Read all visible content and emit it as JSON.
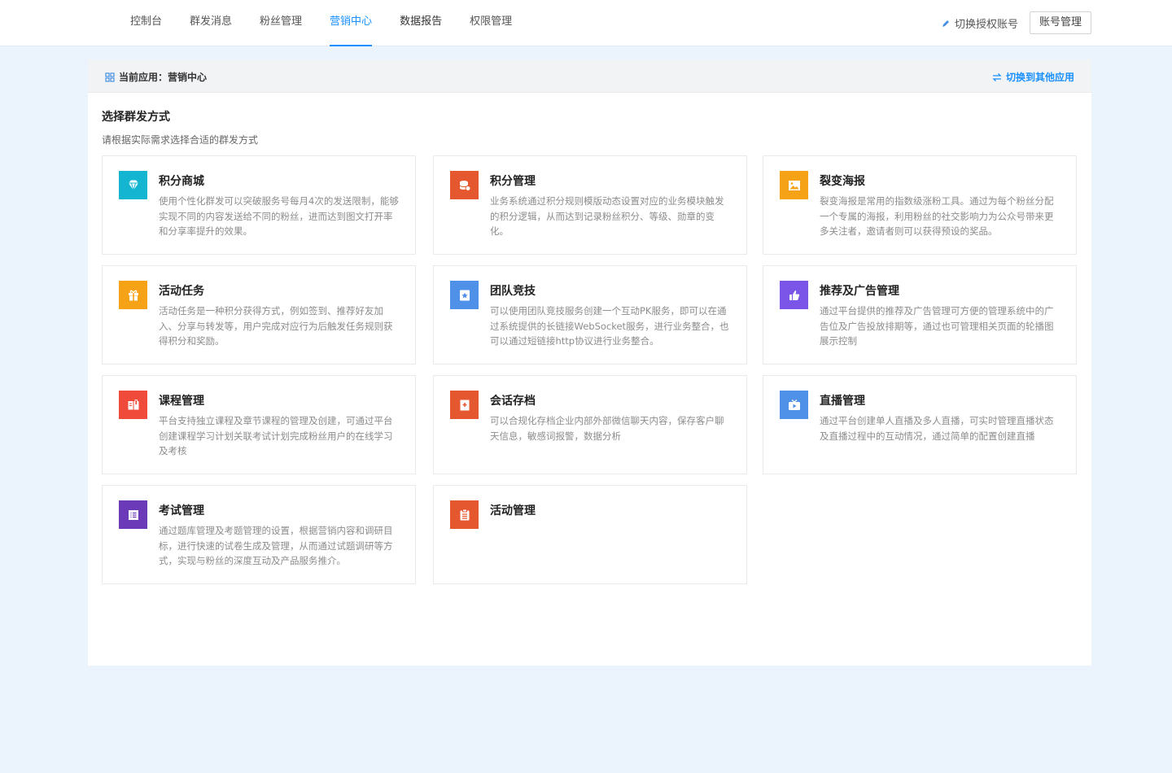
{
  "nav": {
    "items": [
      "控制台",
      "群发消息",
      "粉丝管理",
      "营销中心",
      "数据报告",
      "权限管理"
    ],
    "active_index": 3,
    "switch_auth": "切换授权账号",
    "account_button": "账号管理"
  },
  "app_bar": {
    "current_label": "当前应用：营销中心",
    "switch_label": "切换到其他应用"
  },
  "section": {
    "title": "选择群发方式",
    "subtitle": "请根据实际需求选择合适的群发方式"
  },
  "cards": [
    {
      "title": "积分商城",
      "desc": "使用个性化群发可以突破服务号每月4次的发送限制，能够实现不同的内容发送给不同的粉丝，进而达到图文打开率和分享率提升的效果。",
      "icon": "diamond-icon",
      "color": "#13b5d1"
    },
    {
      "title": "积分管理",
      "desc": "业务系统通过积分规则模版动态设置对应的业务模块触发的积分逻辑，从而达到记录粉丝积分、等级、勋章的变化。",
      "icon": "coins-icon",
      "color": "#e5572e"
    },
    {
      "title": "裂变海报",
      "desc": "裂变海报是常用的指数级涨粉工具。通过为每个粉丝分配一个专属的海报，利用粉丝的社交影响力为公众号带来更多关注者，邀请者则可以获得预设的奖品。",
      "icon": "image-icon",
      "color": "#f6a216"
    },
    {
      "title": "活动任务",
      "desc": "活动任务是一种积分获得方式，例如签到、推荐好友加入、分享与转发等，用户完成对应行为后触发任务规则获得积分和奖励。",
      "icon": "gift-icon",
      "color": "#f6a216"
    },
    {
      "title": "团队竞技",
      "desc": "可以使用团队竞技服务创建一个互动PK服务，即可以在通过系统提供的长链接WebSocket服务，进行业务整合，也可以通过短链接http协议进行业务整合。",
      "icon": "star-badge-icon",
      "color": "#4f90e8"
    },
    {
      "title": "推荐及广告管理",
      "desc": "通过平台提供的推荐及广告管理可方便的管理系统中的广告位及广告投放排期等，通过也可管理相关页面的轮播图展示控制",
      "icon": "thumbs-up-icon",
      "color": "#7a55e8"
    },
    {
      "title": "课程管理",
      "desc": "平台支持独立课程及章节课程的管理及创建，可通过平台创建课程学习计划关联考试计划完成粉丝用户的在线学习及考核",
      "icon": "book-icon",
      "color": "#ef4a3a"
    },
    {
      "title": "会话存档",
      "desc": "可以合规化存档企业内部外部微信聊天内容，保存客户聊天信息，敏感词报警，数据分析",
      "icon": "archive-icon",
      "color": "#e5572e"
    },
    {
      "title": "直播管理",
      "desc": "通过平台创建单人直播及多人直播，可实时管理直播状态及直播过程中的互动情况，通过简单的配置创建直播",
      "icon": "live-tv-icon",
      "color": "#4f90e8"
    },
    {
      "title": "考试管理",
      "desc": "通过题库管理及考题管理的设置，根据营销内容和调研目标，进行快速的试卷生成及管理，从而通过试题调研等方式，实现与粉丝的深度互动及产品服务推介。",
      "icon": "list-icon",
      "color": "#6a3ab8"
    },
    {
      "title": "活动管理",
      "desc": "",
      "icon": "clipboard-icon",
      "color": "#e5572e"
    }
  ],
  "colors": {
    "accent": "#1890ff",
    "page_bg": "#ebf3fd",
    "panel_header_bg": "#f2f3f5"
  }
}
